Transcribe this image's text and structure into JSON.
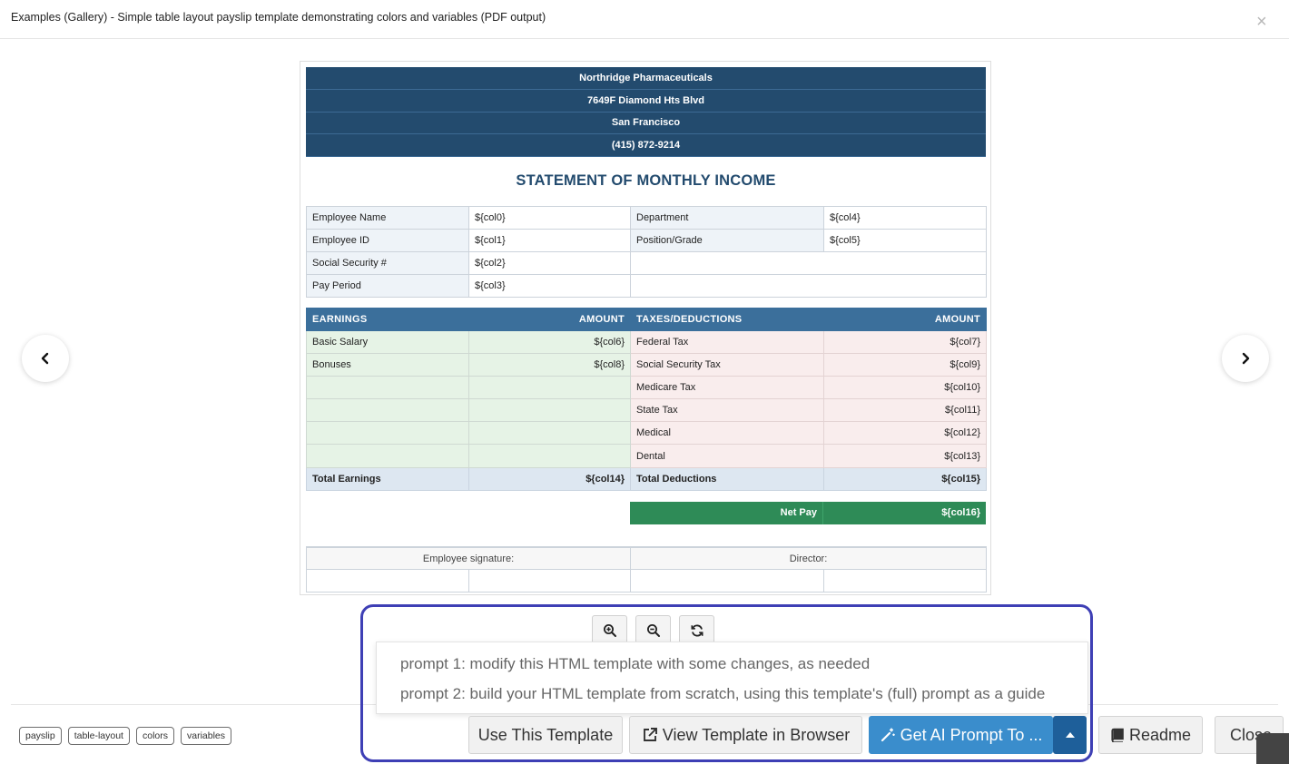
{
  "modal": {
    "title": "Examples (Gallery) - Simple table layout payslip template demonstrating colors and variables (PDF output)",
    "close_glyph": "×"
  },
  "nav": {
    "prev_icon": "chevron-left-icon",
    "next_icon": "chevron-right-icon"
  },
  "company": {
    "name": "Northridge Pharmaceuticals",
    "address": "7649F Diamond Hts Blvd",
    "city": "San Francisco",
    "phone": "(415) 872-9214"
  },
  "statement_title": "STATEMENT OF MONTHLY INCOME",
  "info_rows": [
    {
      "l1": "Employee Name",
      "v1": "${col0}",
      "l2": "Department",
      "v2": "${col4}"
    },
    {
      "l1": "Employee ID",
      "v1": "${col1}",
      "l2": "Position/Grade",
      "v2": "${col5}"
    },
    {
      "l1": "Social Security #",
      "v1": "${col2}",
      "l2": "",
      "v2": ""
    },
    {
      "l1": "Pay Period",
      "v1": "${col3}",
      "l2": "",
      "v2": ""
    }
  ],
  "earnings": {
    "headers": [
      "EARNINGS",
      "AMOUNT",
      "TAXES/DEDUCTIONS",
      "AMOUNT"
    ],
    "rows": [
      {
        "e": "Basic Salary",
        "ea": "${col6}",
        "d": "Federal Tax",
        "da": "${col7}"
      },
      {
        "e": "Bonuses",
        "ea": "${col8}",
        "d": "Social Security Tax",
        "da": "${col9}"
      },
      {
        "e": "",
        "ea": "",
        "d": "Medicare Tax",
        "da": "${col10}"
      },
      {
        "e": "",
        "ea": "",
        "d": "State Tax",
        "da": "${col11}"
      },
      {
        "e": "",
        "ea": "",
        "d": "Medical",
        "da": "${col12}"
      },
      {
        "e": "",
        "ea": "",
        "d": "Dental",
        "da": "${col13}"
      }
    ],
    "total": {
      "e": "Total Earnings",
      "ea": "${col14}",
      "d": "Total Deductions",
      "da": "${col15}"
    }
  },
  "net_pay": {
    "label": "Net Pay",
    "value": "${col16}"
  },
  "signatures": {
    "employee": "Employee signature:",
    "director": "Director:"
  },
  "zoom": {
    "zoom_in_icon": "zoom-in-icon",
    "zoom_out_icon": "zoom-out-icon",
    "reset_icon": "refresh-icon"
  },
  "tags": [
    "payslip",
    "table-layout",
    "colors",
    "variables"
  ],
  "prompt_menu": {
    "item1": "prompt 1: modify this HTML template with some changes, as needed",
    "item2": "prompt 2: build your HTML template from scratch, using this template's (full) prompt as a guide"
  },
  "buttons": {
    "use": "Use This Template",
    "view": "View Template in Browser",
    "ai": "Get AI Prompt To ...",
    "readme": "Readme",
    "close": "Close"
  },
  "colors": {
    "header_navy": "#234b6e",
    "table_header_blue": "#3b6f9b",
    "earnings_green": "#e6f3e6",
    "deductions_pink": "#f9eded",
    "net_pay_green": "#2e8b57",
    "primary_button": "#3a8dcc",
    "highlight_border": "#3e3fb5"
  }
}
